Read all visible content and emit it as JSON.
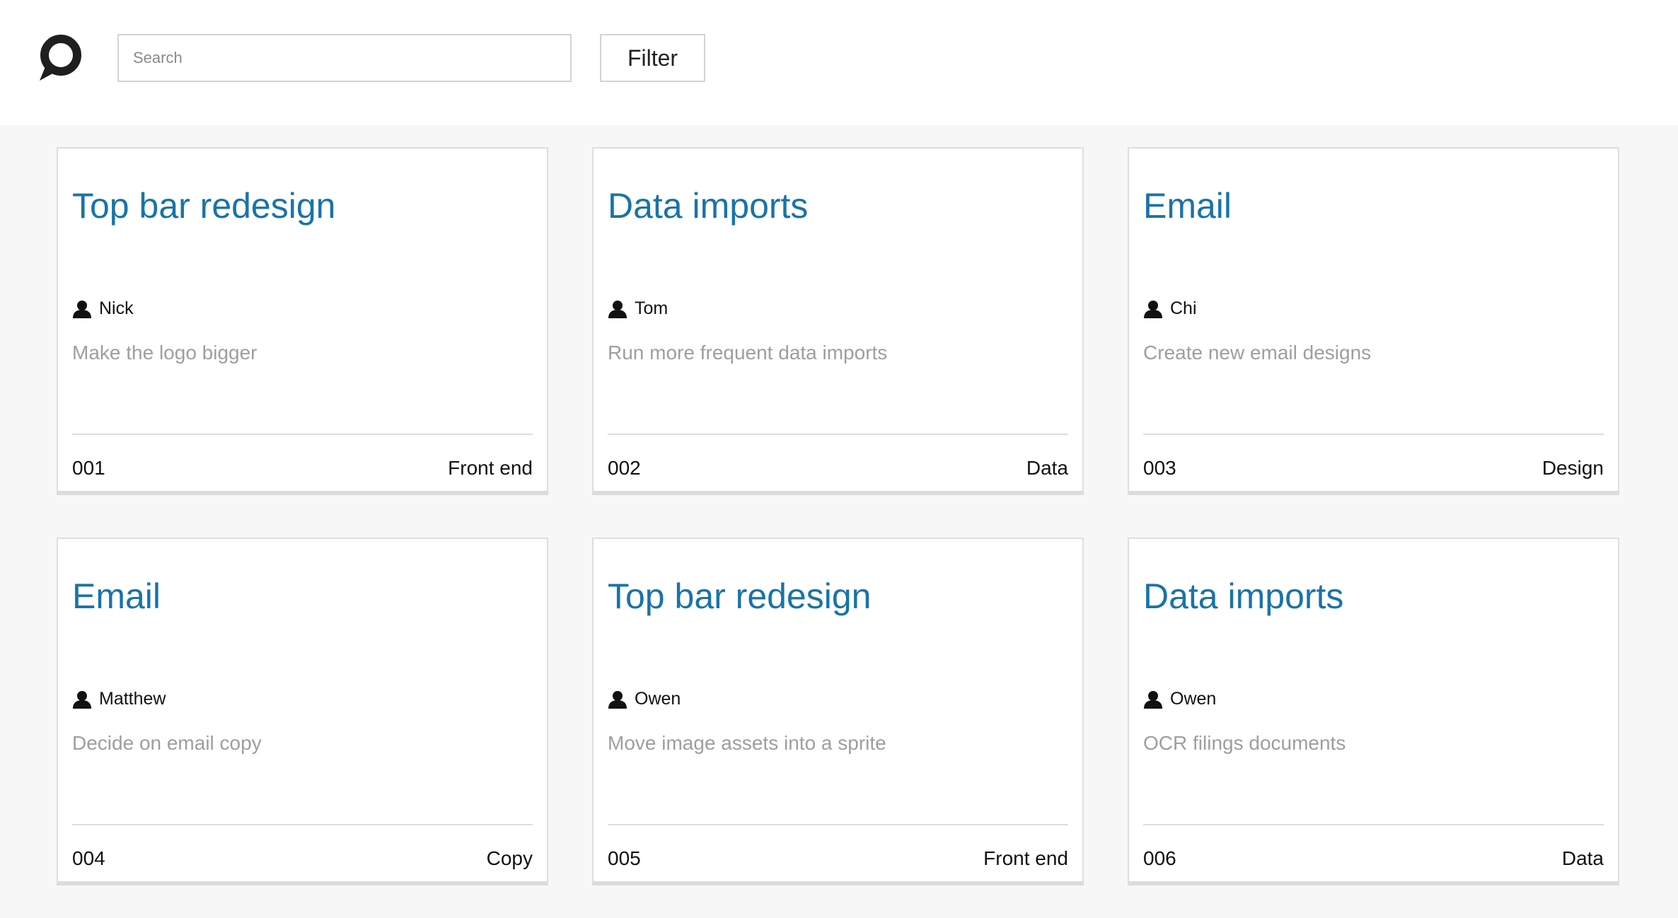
{
  "header": {
    "logo": "search-logo-icon",
    "search_placeholder": "Search",
    "search_value": "",
    "filter_label": "Filter"
  },
  "colors": {
    "title": "#1a73a8",
    "description": "#9e9e9e",
    "background": "#f7f7f7"
  },
  "cards": [
    {
      "title": "Top bar redesign",
      "assignee": "Nick",
      "description": "Make the logo bigger",
      "id": "001",
      "tag": "Front end"
    },
    {
      "title": "Data imports",
      "assignee": "Tom",
      "description": "Run more frequent data imports",
      "id": "002",
      "tag": "Data"
    },
    {
      "title": "Email",
      "assignee": "Chi",
      "description": "Create new email designs",
      "id": "003",
      "tag": "Design"
    },
    {
      "title": "Email",
      "assignee": "Matthew",
      "description": "Decide on email copy",
      "id": "004",
      "tag": "Copy"
    },
    {
      "title": "Top bar redesign",
      "assignee": "Owen",
      "description": "Move image assets into a sprite",
      "id": "005",
      "tag": "Front end"
    },
    {
      "title": "Data imports",
      "assignee": "Owen",
      "description": "OCR filings documents",
      "id": "006",
      "tag": "Data"
    }
  ]
}
